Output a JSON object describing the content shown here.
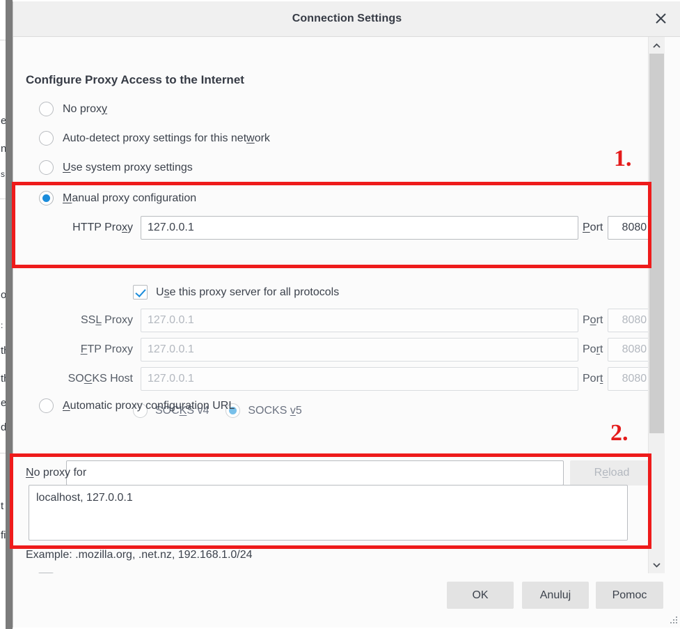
{
  "window": {
    "title": "Connection Settings",
    "close_icon": "close-icon"
  },
  "content": {
    "heading": "Configure Proxy Access to the Internet",
    "proxy_modes": [
      {
        "label": "No proxy",
        "mnemonic": "y",
        "selected": false
      },
      {
        "label": "Auto-detect proxy settings for this network",
        "mnemonic": "w",
        "selected": false
      },
      {
        "label": "Use system proxy settings",
        "mnemonic": "U",
        "selected": false
      },
      {
        "label": "Manual proxy configuration",
        "mnemonic": "M",
        "selected": true
      },
      {
        "label": "Automatic proxy configuration URL",
        "mnemonic": "A",
        "selected": false
      }
    ],
    "manual": {
      "http": {
        "label_pre": "HTTP Pro",
        "label_mnemonic": "x",
        "label_post": "y",
        "value": "127.0.0.1",
        "port_label_pre": "",
        "port_label_mnemonic": "P",
        "port_label_post": "ort",
        "port_value": "8080",
        "disabled": false
      },
      "all_protocols": {
        "label_pre": "U",
        "label_mnemonic": "s",
        "label_post": "e this proxy server for all protocols",
        "checked": true
      },
      "ssl": {
        "label_pre": "SS",
        "label_mnemonic": "L",
        "label_post": " Proxy",
        "value": "127.0.0.1",
        "port_label_pre": "P",
        "port_label_mnemonic": "o",
        "port_label_post": "rt",
        "port_value": "8080",
        "disabled": true
      },
      "ftp": {
        "label_pre": "",
        "label_mnemonic": "F",
        "label_post": "TP Proxy",
        "value": "127.0.0.1",
        "port_label_pre": "Po",
        "port_label_mnemonic": "r",
        "port_label_post": "t",
        "port_value": "8080",
        "disabled": true
      },
      "socks": {
        "label_pre": "SO",
        "label_mnemonic": "C",
        "label_post": "KS Host",
        "value": "127.0.0.1",
        "port_label_pre": "Por",
        "port_label_mnemonic": "t",
        "port_label_post": "",
        "port_value": "8080",
        "disabled": true
      },
      "socks_versions": [
        {
          "label_pre": "SOC",
          "mnemonic": "K",
          "label_post": "S v4",
          "selected": false
        },
        {
          "label_pre": "SOCKS ",
          "mnemonic": "v",
          "label_post": "5",
          "selected": true
        }
      ]
    },
    "pac": {
      "url_value": "",
      "reload_pre": "R",
      "reload_mnemonic": "e",
      "reload_post": "load"
    },
    "no_proxy": {
      "label_pre": "",
      "label_mnemonic": "N",
      "label_post": "o proxy for",
      "value": "localhost, 127.0.0.1",
      "example": "Example: .mozilla.org, .net.nz, 192.168.1.0/24"
    }
  },
  "buttons": {
    "ok": "OK",
    "cancel": "Anuluj",
    "help": "Pomoc"
  },
  "annotations": {
    "step1": "1.",
    "step2": "2.",
    "color": "#ee1b1b"
  },
  "background_fragments": [
    "e",
    "n",
    "s",
    "o",
    ":",
    "th",
    "th",
    "e",
    "d",
    "t",
    "fi"
  ],
  "scrollbar": {
    "up_icon": "chevron-up-icon",
    "down_icon": "chevron-down-icon"
  }
}
